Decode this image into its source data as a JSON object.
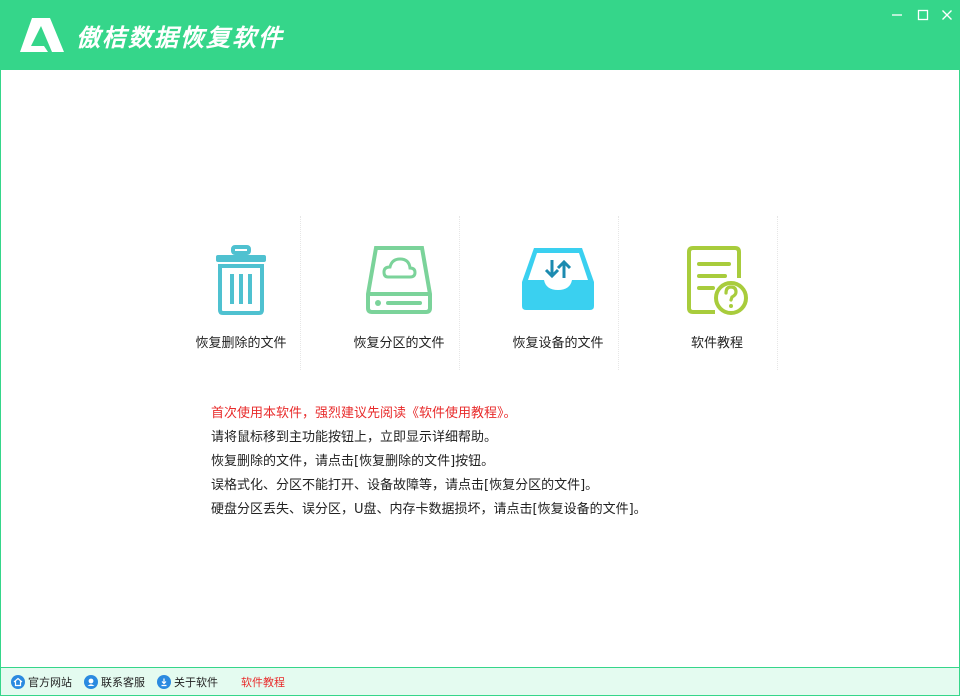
{
  "window": {
    "title": "傲桔数据恢复软件",
    "accent_color": "#35d68a",
    "controls": [
      "minimize-icon",
      "maximize-icon",
      "close-icon"
    ]
  },
  "features": [
    {
      "label": "恢复删除的文件",
      "icon": "trash-icon",
      "color": "#4fc1d0"
    },
    {
      "label": "恢复分区的文件",
      "icon": "hard-drive-icon",
      "color": "#7bd39a"
    },
    {
      "label": "恢复设备的文件",
      "icon": "device-tray-icon",
      "color": "#3ad0f0"
    },
    {
      "label": "软件教程",
      "icon": "tutorial-doc-icon",
      "color": "#a8cc3c"
    }
  ],
  "tips": {
    "warning": "首次使用本软件，强烈建议先阅读《软件使用教程》。",
    "lines": [
      "请将鼠标移到主功能按钮上，立即显示详细帮助。",
      "恢复删除的文件，请点击[恢复删除的文件]按钮。",
      "误格式化、分区不能打开、设备故障等，请点击[恢复分区的文件]。",
      "硬盘分区丢失、误分区，U盘、内存卡数据损坏，请点击[恢复设备的文件]。"
    ],
    "warning_color": "#e82b2b"
  },
  "statusbar": {
    "official_site": "官方网站",
    "contact_support": "联系客服",
    "about": "关于软件",
    "tutorial": "软件教程"
  }
}
